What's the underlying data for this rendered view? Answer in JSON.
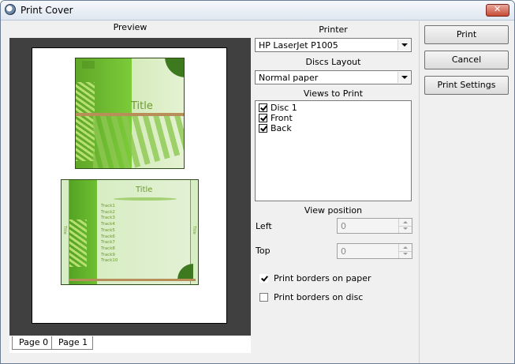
{
  "window": {
    "title": "Print Cover"
  },
  "preview": {
    "label": "Preview",
    "cd_title": "Title",
    "case_title": "Title",
    "tracks": [
      "Track1",
      "Track2",
      "Track3",
      "Track4",
      "Track5",
      "Track6",
      "Track7",
      "Track8",
      "Track9",
      "Track10"
    ],
    "tabs": [
      "Page 0",
      "Page 1"
    ],
    "active_tab": "Page 0"
  },
  "printer": {
    "label": "Printer",
    "value": "HP LaserJet P1005"
  },
  "layout": {
    "label": "Discs Layout",
    "value": "Normal paper"
  },
  "views": {
    "label": "Views to Print",
    "items": [
      {
        "label": "Disc 1",
        "checked": true
      },
      {
        "label": "Front",
        "checked": true
      },
      {
        "label": "Back",
        "checked": true
      }
    ]
  },
  "position": {
    "label": "View position",
    "left_label": "Left",
    "left_value": "0",
    "top_label": "Top",
    "top_value": "0"
  },
  "options": {
    "borders_paper": {
      "label": "Print borders on paper",
      "checked": true
    },
    "borders_disc": {
      "label": "Print borders on disc",
      "checked": false
    }
  },
  "buttons": {
    "print": "Print",
    "cancel": "Cancel",
    "settings": "Print Settings"
  }
}
